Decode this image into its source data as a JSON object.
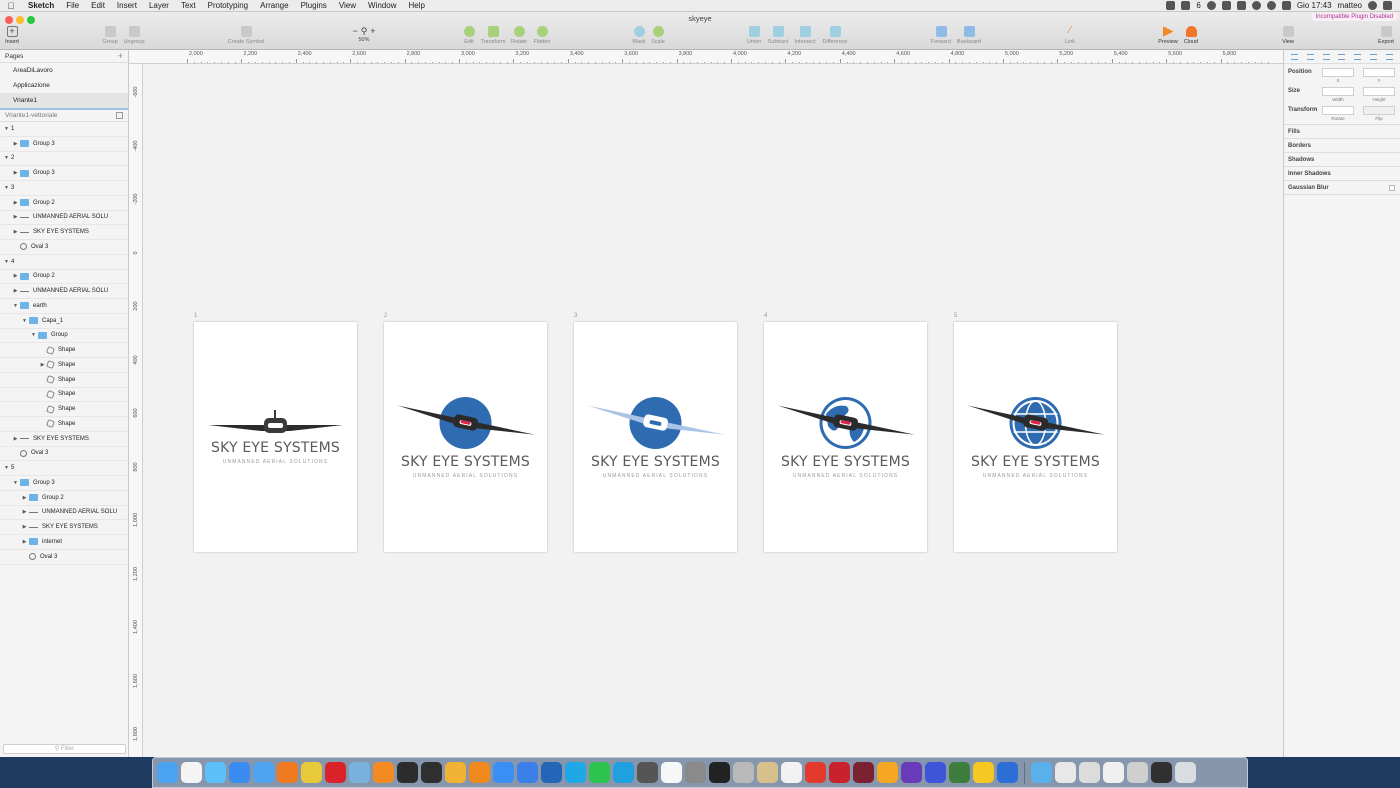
{
  "menubar": {
    "app": "Sketch",
    "items": [
      "File",
      "Edit",
      "Insert",
      "Layer",
      "Text",
      "Prototyping",
      "Arrange",
      "Plugins",
      "View",
      "Window",
      "Help"
    ],
    "status_badge": "6",
    "clock": "Gio 17:43",
    "user": "matteo"
  },
  "window": {
    "title": "skyeye",
    "plugin_warning": "Incompatible Plugin Disabled"
  },
  "toolbar": {
    "insert": "Insert",
    "group": "Group",
    "ungroup": "Ungroup",
    "create_symbol": "Create Symbol",
    "zoom": "50%",
    "edit": "Edit",
    "transform": "Transform",
    "rotate": "Rotate",
    "flatten": "Flatten",
    "mask": "Mask",
    "scale": "Scale",
    "union": "Union",
    "subtract": "Subtract",
    "intersect": "Intersect",
    "difference": "Difference",
    "forward": "Forward",
    "backward": "Backward",
    "link": "Link",
    "preview": "Preview",
    "cloud": "Cloud",
    "view": "View",
    "export": "Export"
  },
  "sidebar": {
    "pages_label": "Pages",
    "pages": [
      "AreaDiLavoro",
      "Applicazione",
      "Vriante1"
    ],
    "layers_title": "Vriante1-vettoriale",
    "filter_placeholder": "Filter",
    "layers": [
      {
        "name": "1",
        "indent": 0,
        "tri": "▼",
        "icon": "none"
      },
      {
        "name": "Group 3",
        "indent": 1,
        "tri": "▶",
        "icon": "folder"
      },
      {
        "name": "2",
        "indent": 0,
        "tri": "▼",
        "icon": "none"
      },
      {
        "name": "Group 3",
        "indent": 1,
        "tri": "▶",
        "icon": "folder"
      },
      {
        "name": "3",
        "indent": 0,
        "tri": "▼",
        "icon": "none"
      },
      {
        "name": "Group 2",
        "indent": 1,
        "tri": "▶",
        "icon": "folder"
      },
      {
        "name": "UNMANNED AERIAL SOLU",
        "indent": 1,
        "tri": "▶",
        "icon": "line"
      },
      {
        "name": "SKY EYE SYSTEMS",
        "indent": 1,
        "tri": "▶",
        "icon": "line"
      },
      {
        "name": "Oval 3",
        "indent": 1,
        "tri": "",
        "icon": "oval"
      },
      {
        "name": "4",
        "indent": 0,
        "tri": "▼",
        "icon": "none"
      },
      {
        "name": "Group 2",
        "indent": 1,
        "tri": "▶",
        "icon": "folder"
      },
      {
        "name": "UNMANNED AERIAL SOLU",
        "indent": 1,
        "tri": "▶",
        "icon": "line"
      },
      {
        "name": "earth",
        "indent": 1,
        "tri": "▼",
        "icon": "folder"
      },
      {
        "name": "Capa_1",
        "indent": 2,
        "tri": "▼",
        "icon": "folder"
      },
      {
        "name": "Group",
        "indent": 3,
        "tri": "▼",
        "icon": "folder"
      },
      {
        "name": "Shape",
        "indent": 4,
        "tri": "",
        "icon": "shape"
      },
      {
        "name": "Shape",
        "indent": 4,
        "tri": "▶",
        "icon": "shape"
      },
      {
        "name": "Shape",
        "indent": 4,
        "tri": "",
        "icon": "shape"
      },
      {
        "name": "Shape",
        "indent": 4,
        "tri": "",
        "icon": "shape"
      },
      {
        "name": "Shape",
        "indent": 4,
        "tri": "",
        "icon": "shape"
      },
      {
        "name": "Shape",
        "indent": 4,
        "tri": "",
        "icon": "shape"
      },
      {
        "name": "SKY EYE SYSTEMS",
        "indent": 1,
        "tri": "▶",
        "icon": "line"
      },
      {
        "name": "Oval 3",
        "indent": 1,
        "tri": "",
        "icon": "oval"
      },
      {
        "name": "5",
        "indent": 0,
        "tri": "▼",
        "icon": "none"
      },
      {
        "name": "Group 3",
        "indent": 1,
        "tri": "▼",
        "icon": "folder"
      },
      {
        "name": "Group 2",
        "indent": 2,
        "tri": "▶",
        "icon": "folder"
      },
      {
        "name": "UNMANNED AERIAL SOLU",
        "indent": 2,
        "tri": "▶",
        "icon": "line"
      },
      {
        "name": "SKY EYE SYSTEMS",
        "indent": 2,
        "tri": "▶",
        "icon": "line"
      },
      {
        "name": "internet",
        "indent": 2,
        "tri": "▶",
        "icon": "folder"
      },
      {
        "name": "Oval 3",
        "indent": 2,
        "tri": "",
        "icon": "oval"
      }
    ]
  },
  "rulers": {
    "horizontal": [
      "2,000",
      "2,200",
      "2,400",
      "2,600",
      "2,800",
      "3,000",
      "3,200",
      "3,400",
      "3,600",
      "3,800",
      "4,000",
      "4,200",
      "4,400",
      "4,600",
      "4,800",
      "5,000",
      "5,200",
      "5,400",
      "5,600",
      "5,800"
    ],
    "vertical": [
      "-600",
      "-400",
      "-200",
      "0",
      "200",
      "400",
      "600",
      "800",
      "1,000",
      "1,200",
      "1,400",
      "1,600",
      "1,800"
    ]
  },
  "artboards": [
    {
      "label": "1",
      "variant": "plain"
    },
    {
      "label": "2",
      "variant": "circle"
    },
    {
      "label": "3",
      "variant": "circle-white"
    },
    {
      "label": "4",
      "variant": "earth"
    },
    {
      "label": "5",
      "variant": "globe"
    }
  ],
  "logo": {
    "title": "SKY EYE SYSTEMS",
    "subtitle": "UNMANNED AERIAL SOLUTIONS",
    "brand_blue": "#2e6bb0",
    "dark": "#2b2b2b",
    "accent_red": "#e0224a"
  },
  "inspector": {
    "position": "Position",
    "x": "X",
    "y": "Y",
    "size": "Size",
    "width": "Width",
    "height": "Height",
    "transform": "Transform",
    "rotate": "Rotate",
    "flip": "Flip",
    "sections": [
      "Fills",
      "Borders",
      "Shadows",
      "Inner Shadows",
      "Gaussian Blur"
    ]
  },
  "dock": {
    "icons": [
      "finder-icon",
      "calendar-icon",
      "messages-icon",
      "app-store-icon",
      "safari-icon",
      "firefox-icon",
      "chrome-icon",
      "opera-icon",
      "preview-icon",
      "xampp-icon",
      "sourcetree-icon",
      "photo-icon",
      "sketch-icon",
      "illustrator-icon",
      "mail-icon",
      "maps-icon",
      "quicktime-icon",
      "skype-icon",
      "whatsapp-icon",
      "skype-business-icon",
      "camera-icon",
      "textedit-icon",
      "system-prefs-icon",
      "terminal-icon",
      "ftp-icon",
      "notes-icon",
      "pages-icon",
      "pdf-icon",
      "acrobat-icon",
      "affinity-icon",
      "photos-icon",
      "imovie-icon",
      "star-icon",
      "monitor-icon",
      "tasks-icon",
      "voice-icon",
      "folder-icon",
      "at-icon",
      "archive-icon",
      "documents-icon",
      "keynote-icon",
      "console-icon",
      "trash-icon"
    ],
    "colors": [
      "#4aa3f0",
      "#f4f4f4",
      "#5ec0f8",
      "#3b8cf0",
      "#4fa5f2",
      "#f07a20",
      "#e8c93a",
      "#d9222a",
      "#7ab0dc",
      "#f48a22",
      "#2c2c2c",
      "#2f2f2f",
      "#f2b233",
      "#f08a1c",
      "#3a8ff4",
      "#3b7fe8",
      "#2366b8",
      "#1fa8e6",
      "#2cc44f",
      "#1fa0e0",
      "#555555",
      "#f7f7f7",
      "#8a8a8a",
      "#222222",
      "#b9b9b9",
      "#d8c08c",
      "#f2f2f2",
      "#e23b2e",
      "#c8232c",
      "#7a2232",
      "#f5a623",
      "#6a3bb8",
      "#3d55d8",
      "#3f7d3f",
      "#f5c823",
      "#2d6ed6",
      "#5ab0ea",
      "#e8e8e8",
      "#dcdcdc",
      "#f0f0f0",
      "#cfcfcf",
      "#303030",
      "#d9dde2"
    ]
  }
}
